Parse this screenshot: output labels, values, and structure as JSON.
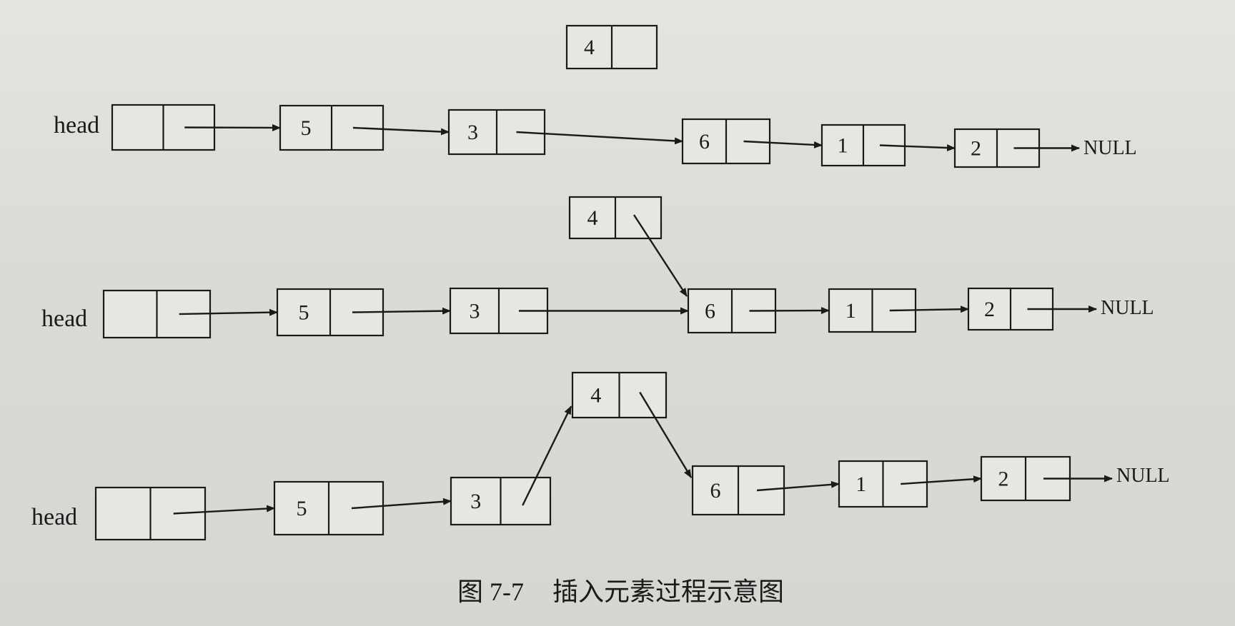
{
  "head_label": "head",
  "null_label": "NULL",
  "caption": {
    "number": "图 7-7",
    "title": "插入元素过程示意图"
  },
  "rows": [
    {
      "id": "step-1",
      "list": [
        "",
        "5",
        "3",
        "6",
        "1",
        "2"
      ],
      "new_node": "4",
      "new_linked": false
    },
    {
      "id": "step-2",
      "list": [
        "",
        "5",
        "3",
        "6",
        "1",
        "2"
      ],
      "new_node": "4",
      "new_linked": "to-next"
    },
    {
      "id": "step-3",
      "list": [
        "",
        "5",
        "3",
        "6",
        "1",
        "2"
      ],
      "new_node": "4",
      "new_linked": "inserted"
    }
  ]
}
